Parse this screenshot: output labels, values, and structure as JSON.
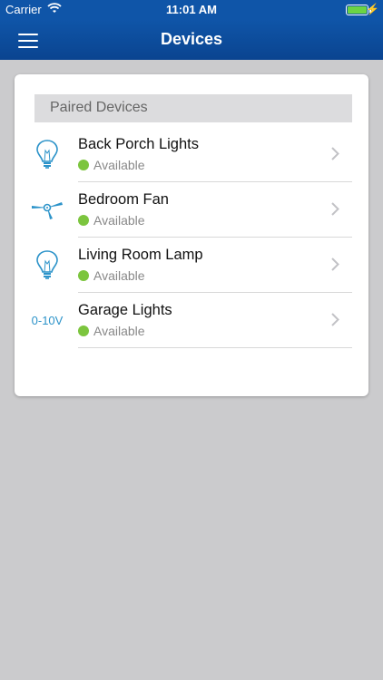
{
  "status_bar": {
    "carrier": "Carrier",
    "time": "11:01 AM",
    "battery_color": "#6bd443"
  },
  "nav": {
    "title": "Devices",
    "menu_icon": "hamburger-icon"
  },
  "section": {
    "title": "Paired Devices"
  },
  "devices": [
    {
      "name": "Back Porch Lights",
      "status": "Available",
      "icon": "bulb-icon"
    },
    {
      "name": "Bedroom Fan",
      "status": "Available",
      "icon": "ceiling-fan-icon"
    },
    {
      "name": "Living Room Lamp",
      "status": "Available",
      "icon": "bulb-icon"
    },
    {
      "name": "Garage Lights",
      "status": "Available",
      "icon": "dimmer-text-icon",
      "icon_text": "0-10V"
    }
  ],
  "colors": {
    "nav_blue": "#0f55a8",
    "status_green": "#7cc53e",
    "icon_blue": "#2c93c9"
  }
}
